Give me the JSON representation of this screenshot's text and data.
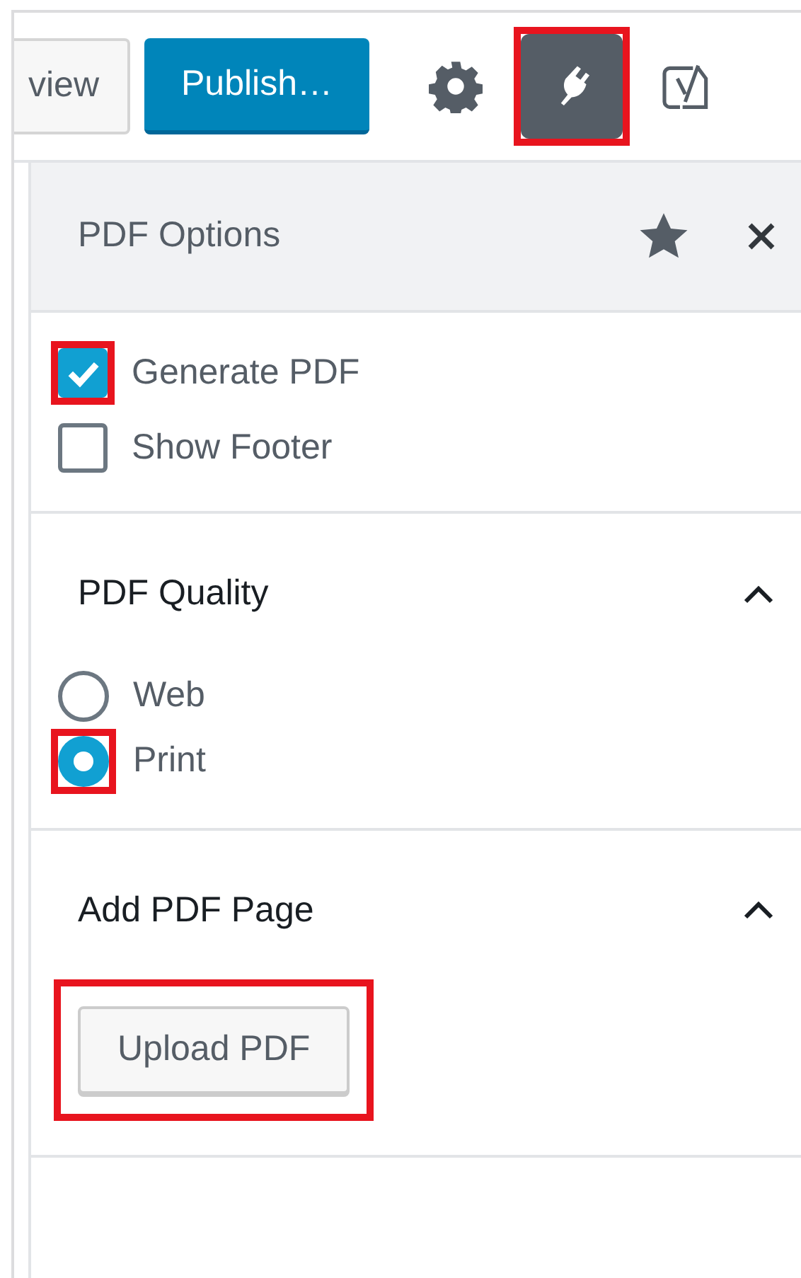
{
  "toolbar": {
    "buttons": [
      {
        "kind": "secondary",
        "label": "view",
        "highlighted": false
      },
      {
        "kind": "primary",
        "label": "Publish…",
        "highlighted": false
      },
      {
        "kind": "gear",
        "selected": false,
        "highlighted": false
      },
      {
        "kind": "plug",
        "selected": true,
        "highlighted": true
      },
      {
        "kind": "yoast",
        "selected": false,
        "highlighted": false
      }
    ]
  },
  "panel": {
    "title": "PDF Options",
    "options": [
      {
        "label": "Generate PDF",
        "checked": true,
        "highlighted": true
      },
      {
        "label": "Show Footer",
        "checked": false,
        "highlighted": false
      }
    ],
    "sections": [
      {
        "title": "PDF Quality",
        "expanded": true,
        "kind": "radios",
        "items": [
          {
            "label": "Web",
            "selected": false,
            "highlighted": false
          },
          {
            "label": "Print",
            "selected": true,
            "highlighted": true
          }
        ]
      },
      {
        "title": "Add PDF Page",
        "expanded": true,
        "kind": "button",
        "button": {
          "label": "Upload PDF",
          "highlighted": true
        }
      }
    ]
  }
}
